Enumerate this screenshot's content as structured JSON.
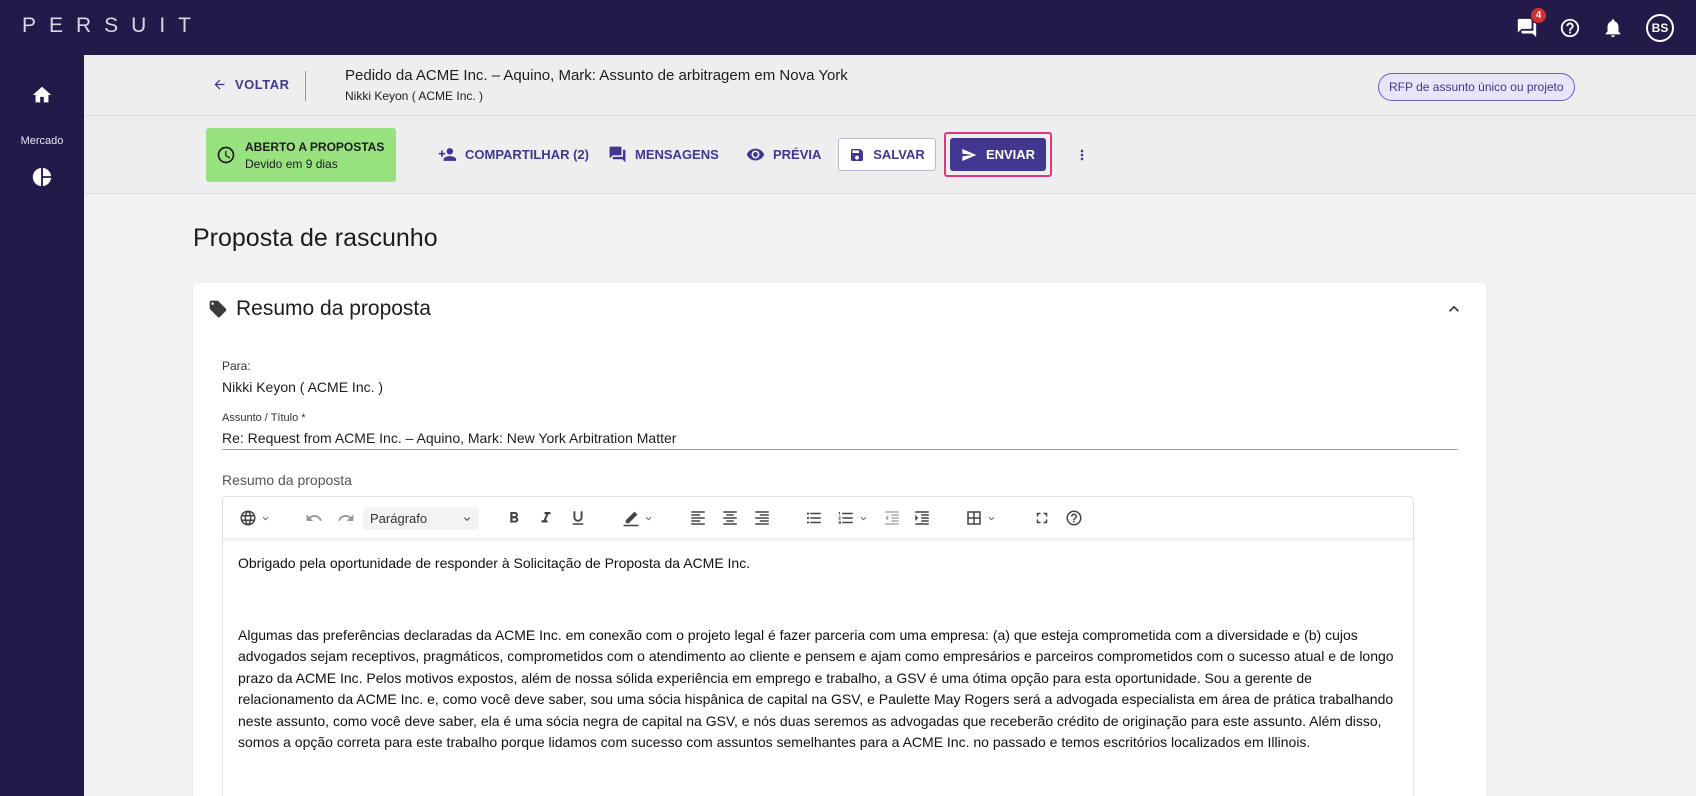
{
  "app": {
    "logo": "PERSUIT"
  },
  "topbar": {
    "messages_badge": "4",
    "avatar_initials": "BS"
  },
  "sidebar": {
    "market_label": "Mercado"
  },
  "header": {
    "back_label": "VOLTAR",
    "request_title": "Pedido da ACME Inc. – Aquino, Mark: Assunto de arbitragem em Nova York",
    "request_subtitle": "Nikki Keyon ( ACME Inc. )",
    "rfp_type": "RFP de assunto único ou projeto"
  },
  "status": {
    "title": "ABERTO A PROPOSTAS",
    "due": "Devido em 9 dias",
    "color": "#98e17f"
  },
  "toolbar": {
    "share_label": "COMPARTILHAR (2)",
    "messages_label": "MENSAGENS",
    "preview_label": "PRÉVIA",
    "save_label": "SALVAR",
    "send_label": "ENVIAR"
  },
  "page": {
    "title": "Proposta de rascunho"
  },
  "summary": {
    "section_title": "Resumo da proposta",
    "to_label": "Para:",
    "to_value": "Nikki Keyon ( ACME Inc. )",
    "subject_label": "Assunto / Título *",
    "subject_value": "Re: Request from ACME Inc. – Aquino, Mark: New York Arbitration Matter",
    "editor_label": "Resumo da proposta"
  },
  "editor": {
    "paragraph_style": "Parágrafo",
    "paragraph1": "Obrigado pela oportunidade de responder à Solicitação de Proposta da ACME Inc.",
    "paragraph2": "Algumas das preferências declaradas da ACME Inc. em conexão com o projeto legal é fazer parceria com uma empresa: (a) que esteja comprometida com a diversidade e (b) cujos advogados sejam receptivos, pragmáticos, comprometidos com o atendimento ao cliente e pensem e ajam como empresários e parceiros comprometidos com o sucesso atual e de longo prazo da ACME Inc. Pelos motivos expostos, além de nossa sólida experiência em emprego e trabalho, a GSV é uma ótima opção para esta oportunidade. Sou a gerente de relacionamento da ACME Inc. e, como você deve saber, sou uma sócia hispânica de capital na GSV, e Paulette May Rogers será a advogada especialista em área de prática trabalhando neste assunto, como você deve saber, ela é uma sócia negra de capital na GSV, e nós duas seremos as advogadas que receberão crédito de originação para este assunto. Além disso, somos a opção correta para este trabalho porque lidamos com sucesso com assuntos semelhantes para a ACME Inc. no passado e temos escritórios localizados em Illinois."
  },
  "colors": {
    "brand_dark": "#231a4a",
    "accent": "#413791",
    "highlight": "#e0357f"
  }
}
